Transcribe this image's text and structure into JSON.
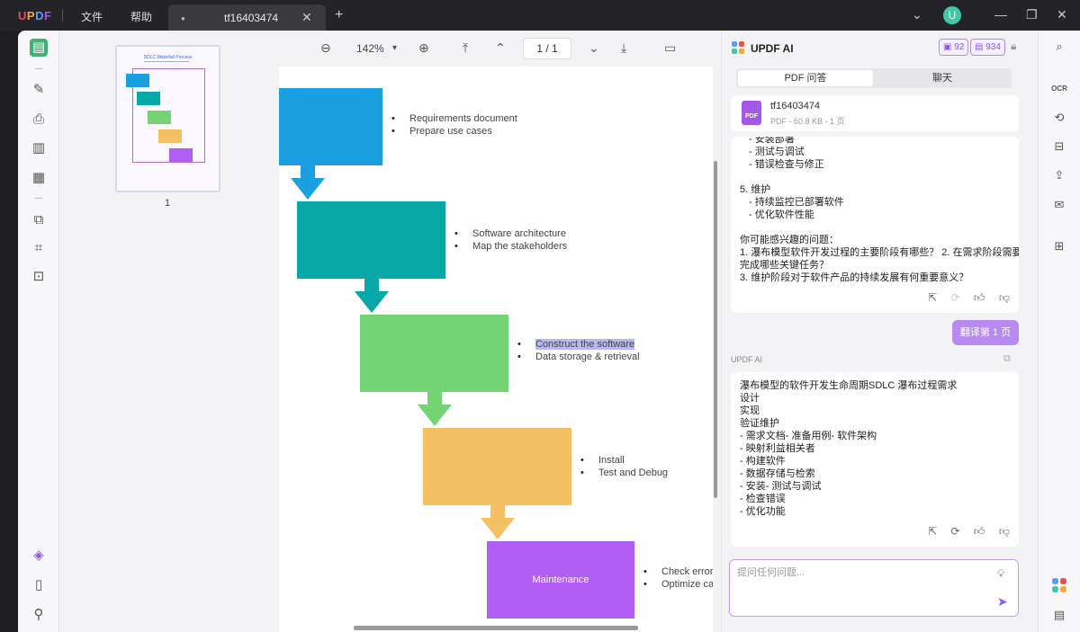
{
  "app": {
    "logo": "UPDF",
    "menu": [
      "文件",
      "帮助"
    ],
    "tab_title": "tf16403474",
    "avatar_letter": "U"
  },
  "toolbar": {
    "zoom": "142%",
    "page": "1 / 1"
  },
  "thumbnail": {
    "title": "SDLC Waterfall Process",
    "page_number": "1"
  },
  "diagram": {
    "steps": [
      {
        "label": "",
        "color": "#1aa0e0",
        "bullets": [
          "Requirements document",
          "Prepare use cases"
        ]
      },
      {
        "label": "",
        "color": "#07a8a8",
        "bullets": [
          "Software architecture",
          "Map the stakeholders"
        ]
      },
      {
        "label": "",
        "color": "#74d474",
        "bullets": [
          "Construct the software",
          "Data storage & retrieval"
        ]
      },
      {
        "label": "",
        "color": "#f5bf63",
        "bullets": [
          "Install",
          "Test and Debug"
        ]
      },
      {
        "label": "Maintenance",
        "color": "#b25ef5",
        "bullets": [
          "Check errors",
          "Optimize ca"
        ]
      }
    ]
  },
  "ai_panel": {
    "title": "UPDF AI",
    "credits_a": "92",
    "credits_b": "934",
    "tab_pdf": "PDF 问答",
    "tab_chat": "聊天",
    "file_name": "tf16403474",
    "file_meta": "PDF - 60.8 KB - 1 页",
    "message1_lines": [
      "- 安装部署",
      "- 测试与调试",
      "- 错误检查与修正",
      "",
      "5. 维护",
      "- 持续监控已部署软件",
      "- 优化软件性能",
      "",
      "你可能感兴趣的问题：",
      "1. 瀑布模型软件开发过程的主要阶段有哪些？ 2. 在需求阶段需要",
      "完成哪些关键任务？",
      "3. 维护阶段对于软件产品的持续发展有何重要意义？"
    ],
    "user_prompt": "翻译第 1 页",
    "ai_label": "UPDF AI",
    "message2_lines": [
      "瀑布模型的软件开发生命周期SDLC 瀑布过程需求",
      "设计",
      "实现",
      "验证维护",
      "- 需求文档- 准备用例- 软件架构",
      "- 映射利益相关者",
      "- 构建软件",
      "- 数据存储与检索",
      "- 安装- 测试与调试",
      "- 检查错误",
      "- 优化功能"
    ],
    "input_placeholder": "提问任何问题..."
  }
}
